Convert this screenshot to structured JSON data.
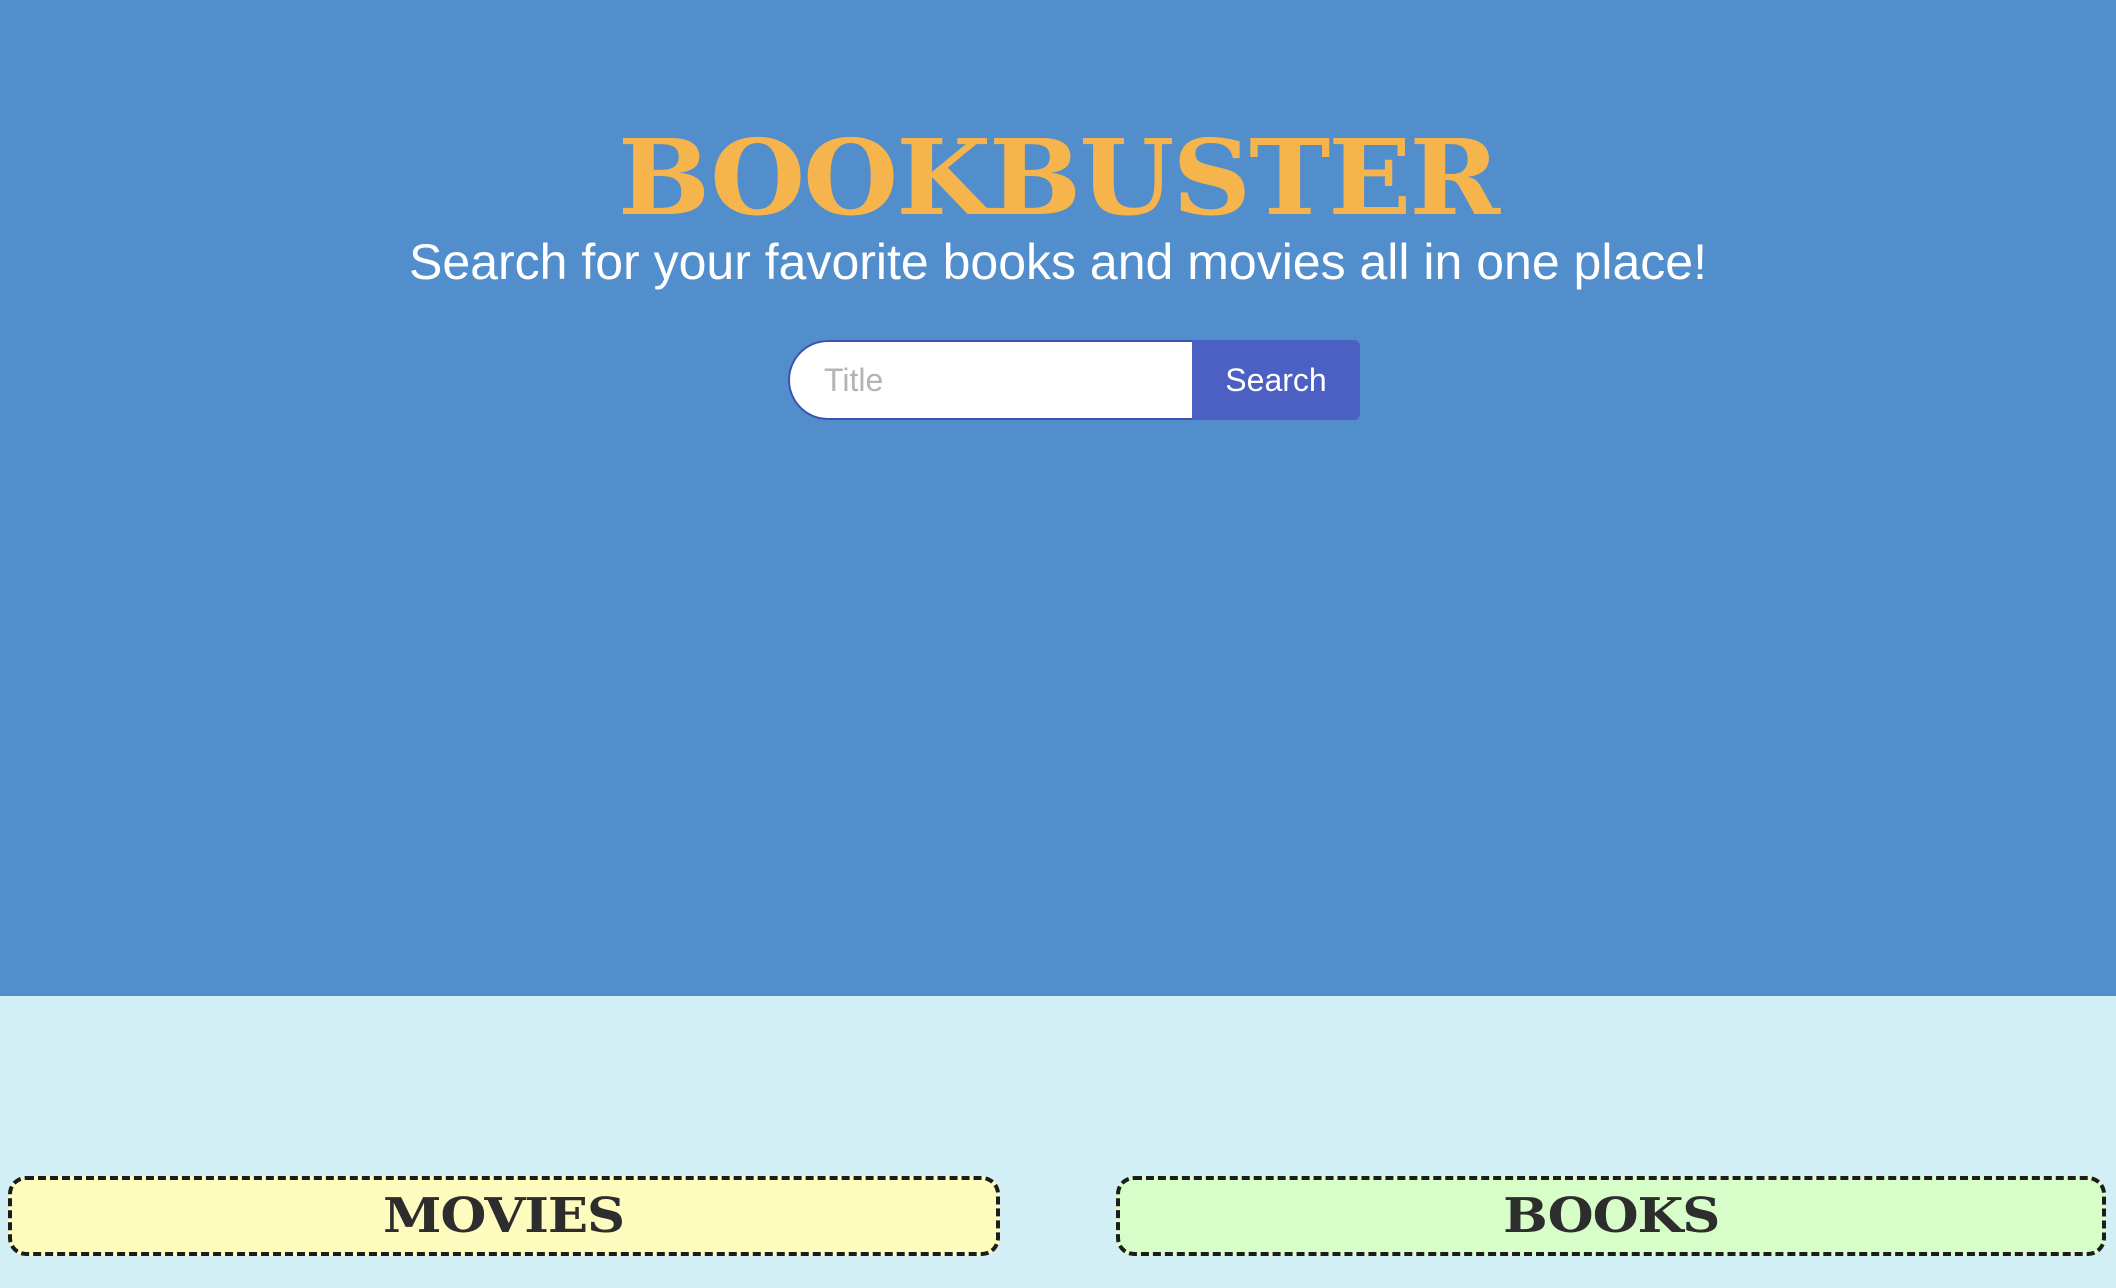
{
  "header": {
    "brand": "BOOKBUSTER",
    "tagline": "Search for your favorite books and movies all in one place!"
  },
  "search": {
    "placeholder": "Title",
    "value": "",
    "button_label": "Search"
  },
  "categories": [
    {
      "label": "MOVIES",
      "color": "#fdfcbe"
    },
    {
      "label": "BOOKS",
      "color": "#d7fdc9"
    }
  ],
  "colors": {
    "hero_background": "#528dcc",
    "page_background": "#d3eff6",
    "brand": "#f6b54c",
    "button": "#4c5fc2"
  }
}
